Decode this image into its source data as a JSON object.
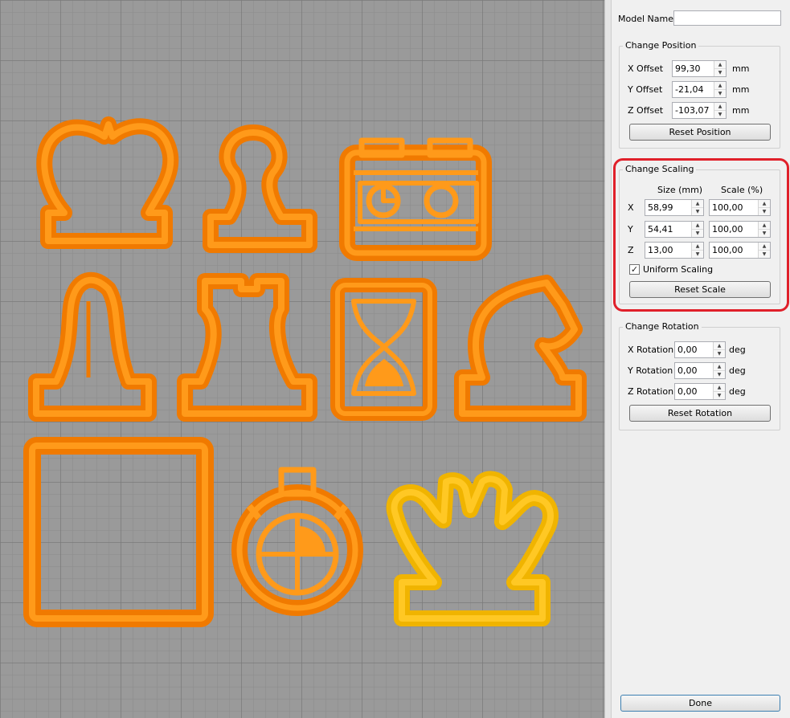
{
  "model_name": {
    "label": "Model Name:",
    "value": ""
  },
  "position": {
    "title": "Change Position",
    "rows": [
      {
        "label": "X Offset",
        "value": "99,30",
        "unit": "mm"
      },
      {
        "label": "Y Offset",
        "value": "-21,04",
        "unit": "mm"
      },
      {
        "label": "Z Offset",
        "value": "-103,07",
        "unit": "mm"
      }
    ],
    "reset_label": "Reset Position"
  },
  "scaling": {
    "title": "Change Scaling",
    "col_size": "Size (mm)",
    "col_scale": "Scale (%)",
    "rows": [
      {
        "axis": "X",
        "size": "58,99",
        "scale": "100,00"
      },
      {
        "axis": "Y",
        "size": "54,41",
        "scale": "100,00"
      },
      {
        "axis": "Z",
        "size": "13,00",
        "scale": "100,00"
      }
    ],
    "uniform_label": "Uniform Scaling",
    "uniform_checked": "✓",
    "reset_label": "Reset Scale"
  },
  "rotation": {
    "title": "Change Rotation",
    "rows": [
      {
        "label": "X Rotation",
        "value": "0,00",
        "unit": "deg"
      },
      {
        "label": "Y Rotation",
        "value": "0,00",
        "unit": "deg"
      },
      {
        "label": "Z Rotation",
        "value": "0,00",
        "unit": "deg"
      }
    ],
    "reset_label": "Reset Rotation"
  },
  "done_label": "Done",
  "colors": {
    "cutter_orange": "#ff8c00",
    "cutter_selected": "#ffc200",
    "grid_bg": "#9a9a9a",
    "highlight": "#e0202a"
  }
}
